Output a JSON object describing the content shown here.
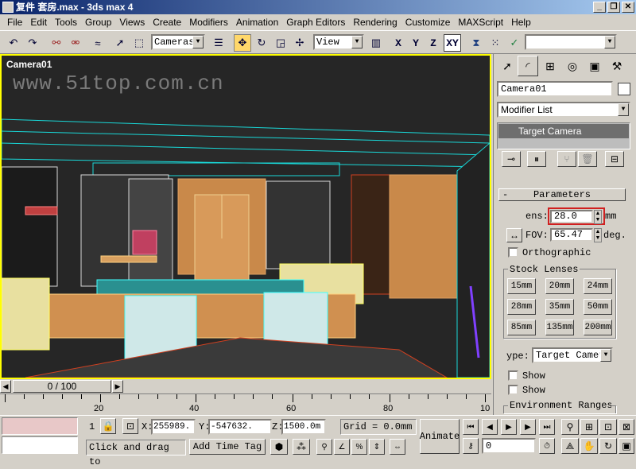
{
  "window": {
    "title": "复件 套房.max - 3ds max 4"
  },
  "menu": [
    "File",
    "Edit",
    "Tools",
    "Group",
    "Views",
    "Create",
    "Modifiers",
    "Animation",
    "Graph Editors",
    "Rendering",
    "Customize",
    "MAXScript",
    "Help"
  ],
  "toolbar": {
    "ref_coord": "Cameras",
    "view_select": "View",
    "axis_x": "X",
    "axis_y": "Y",
    "axis_z": "Z",
    "axis_xy": "XY"
  },
  "viewport": {
    "label": "Camera01",
    "watermark": "www.51top.com.cn"
  },
  "cmdpanel": {
    "object_name": "Camera01",
    "modifier_list": "Modifier List",
    "stack_item": "Target Camera",
    "parameters_header": "Parameters",
    "lens_label": "ens:",
    "lens_value": "28.0",
    "lens_unit": "mm",
    "fov_label": "FOV:",
    "fov_value": "65.47",
    "fov_unit": "deg.",
    "orthographic": "Orthographic",
    "stock_lenses": "Stock Lenses",
    "lenses": [
      "15mm",
      "20mm",
      "24mm",
      "28mm",
      "35mm",
      "50mm",
      "85mm",
      "135mm",
      "200mm"
    ],
    "type_label": "ype:",
    "type_value": "Target Camer",
    "show1": "Show",
    "show2": "Show",
    "env_ranges": "Environment Ranges"
  },
  "timeslider": {
    "value": "0 / 100"
  },
  "timeline": {
    "ticks": [
      "20",
      "40",
      "60",
      "80",
      "10"
    ]
  },
  "status": {
    "selected_count": "1",
    "x_label": "X:",
    "x_value": "255989.",
    "y_label": "Y:",
    "y_value": "-547632.",
    "z_label": "Z:",
    "z_value": "1500.0m",
    "grid": "Grid = 0.0mm",
    "prompt": "Click and drag to",
    "add_time_tag": "Add Time Tag",
    "animate": "Animate",
    "frame": "0"
  },
  "colors": {
    "viewport_border": "#ffff00",
    "lens_highlight": "#d02020",
    "title_start": "#0a246a"
  }
}
